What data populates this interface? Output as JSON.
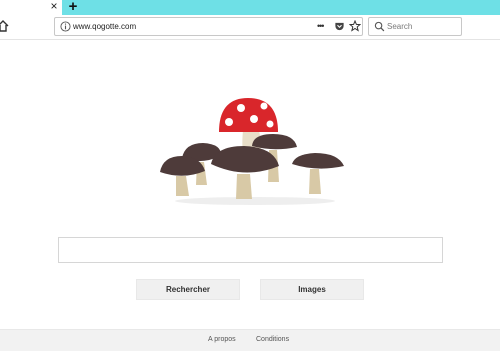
{
  "browser": {
    "tab_close_glyph": "×",
    "new_tab_glyph": "+",
    "url": "www.qogotte.com",
    "page_actions_glyph": "•••",
    "search_placeholder": "Search",
    "accent_color": "#6ee0e6"
  },
  "page": {
    "logo_icon": "mushrooms-illustration",
    "search_button_label": "Rechercher",
    "images_button_label": "Images"
  },
  "footer": {
    "about_label": "A propos",
    "terms_label": "Conditions"
  }
}
